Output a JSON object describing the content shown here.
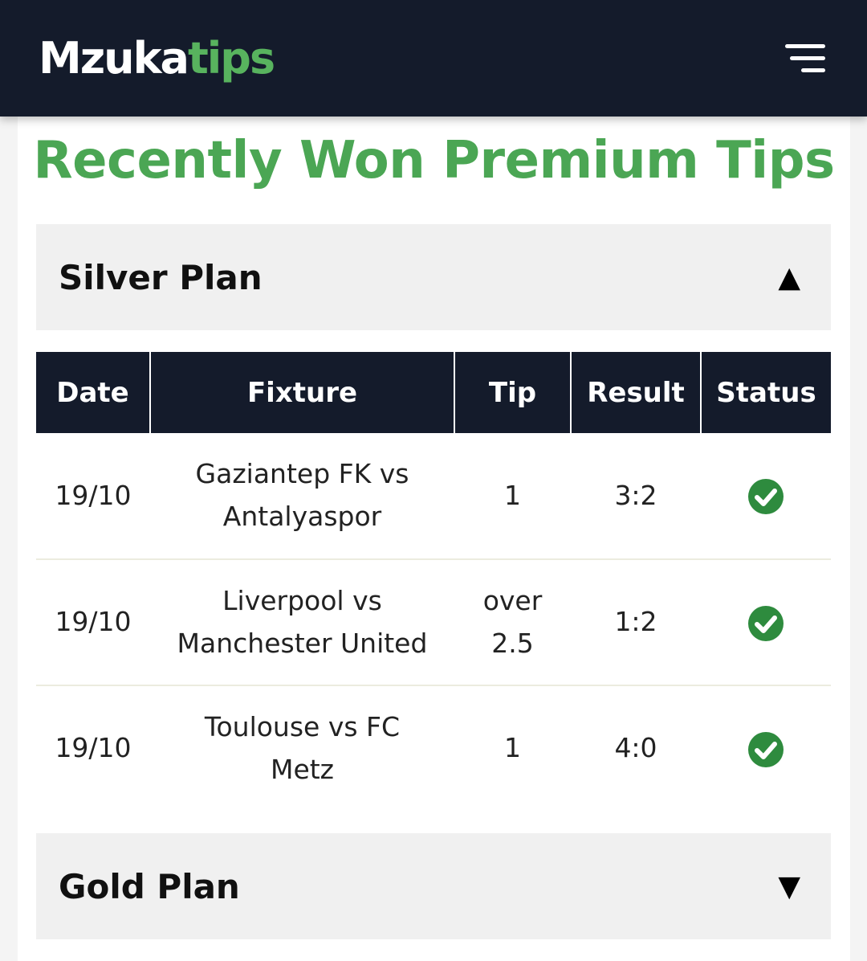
{
  "header": {
    "logo_part1": "Mzuka",
    "logo_part2": "tips"
  },
  "page": {
    "title": "Recently Won Premium Tips"
  },
  "plans": {
    "silver": {
      "label": "Silver Plan",
      "arrow": "▲"
    },
    "gold": {
      "label": "Gold Plan",
      "arrow": "▼"
    }
  },
  "table": {
    "headers": [
      "Date",
      "Fixture",
      "Tip",
      "Result",
      "Status"
    ],
    "rows": [
      {
        "date": "19/10",
        "fixture": "Gaziantep FK vs Antalyaspor",
        "tip": "1",
        "result": "3:2",
        "status": "won"
      },
      {
        "date": "19/10",
        "fixture": "Liverpool vs Manchester United",
        "tip": "over 2.5",
        "result": "1:2",
        "status": "won"
      },
      {
        "date": "19/10",
        "fixture": "Toulouse vs FC Metz",
        "tip": "1",
        "result": "4:0",
        "status": "won"
      }
    ]
  },
  "icons": {
    "menu": "hamburger-menu-icon",
    "status": "check-circle-icon"
  },
  "colors": {
    "header_bg": "#141b2b",
    "accent_green": "#4ba654",
    "check_green": "#2e8b3e"
  }
}
